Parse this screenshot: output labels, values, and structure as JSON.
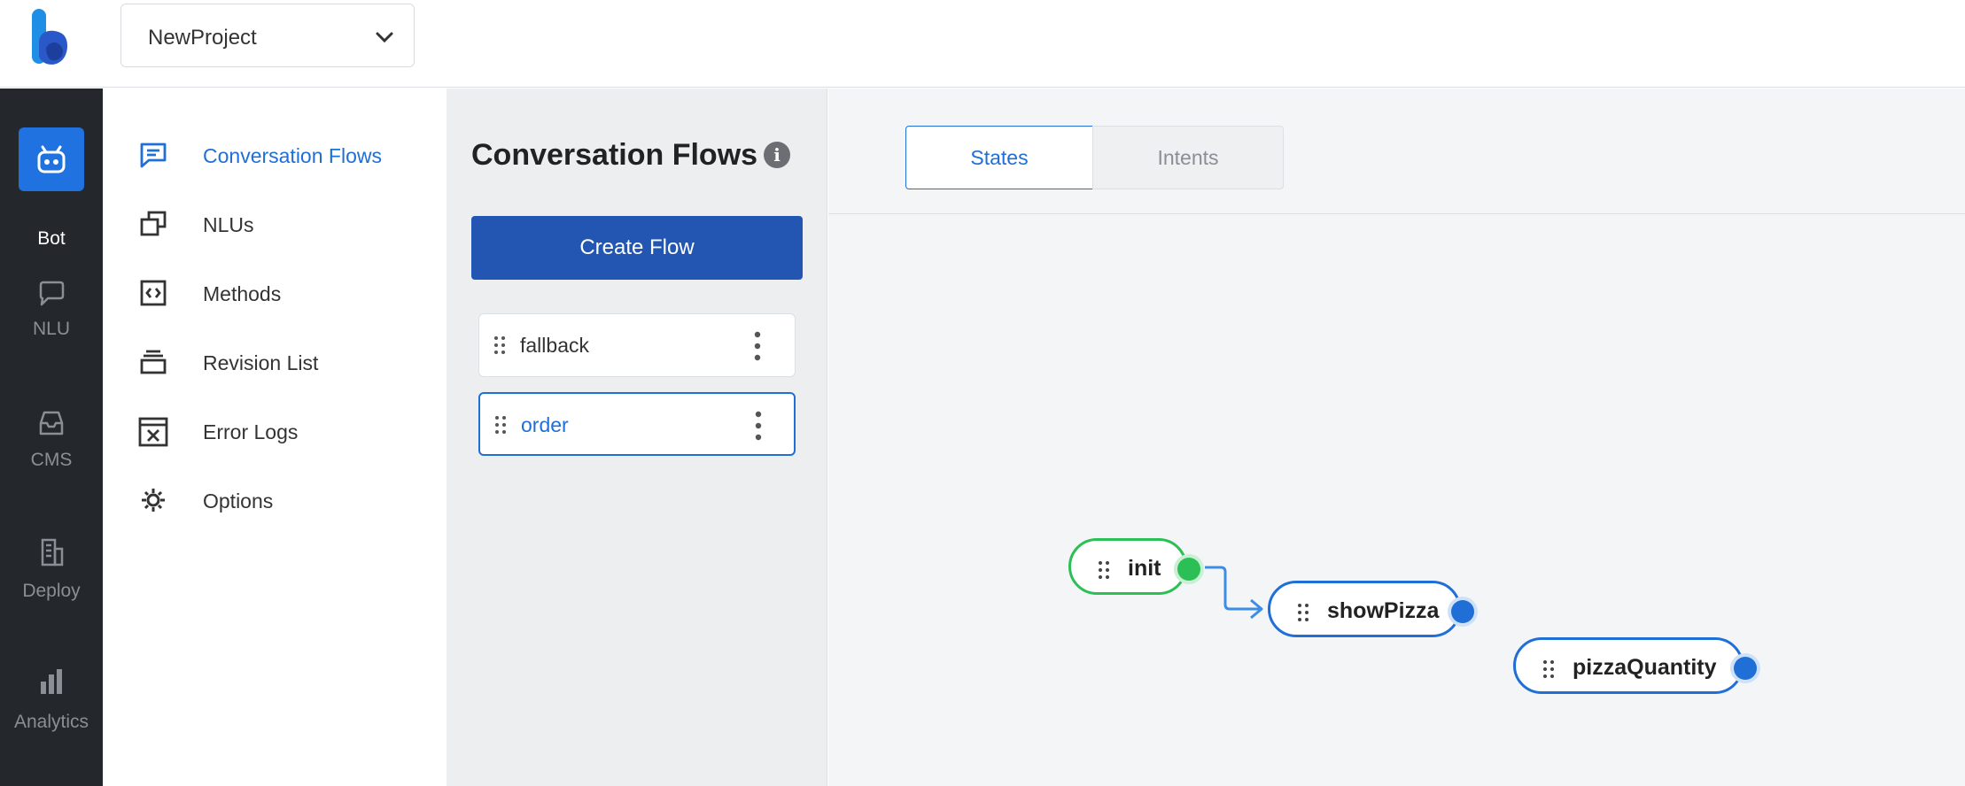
{
  "app": {
    "logo_icon": "logo-k-icon",
    "accent": "#1f72e0"
  },
  "project_select": {
    "value": "NewProject",
    "icon": "chevron-down-icon"
  },
  "rail": {
    "items": [
      {
        "label": "Bot",
        "icon": "robot-icon",
        "active": true
      },
      {
        "label": "NLU",
        "icon": "chat-bubble-icon",
        "active": false
      },
      {
        "label": "CMS",
        "icon": "inbox-icon",
        "active": false
      },
      {
        "label": "Deploy",
        "icon": "building-icon",
        "active": false
      },
      {
        "label": "Analytics",
        "icon": "bar-chart-icon",
        "active": false
      }
    ]
  },
  "subnav": {
    "items": [
      {
        "label": "Conversation Flows",
        "icon": "message-square-icon",
        "active": true
      },
      {
        "label": "NLUs",
        "icon": "copy-windows-icon",
        "active": false
      },
      {
        "label": "Methods",
        "icon": "code-box-icon",
        "active": false
      },
      {
        "label": "Revision List",
        "icon": "stack-icon",
        "active": false
      },
      {
        "label": "Error Logs",
        "icon": "error-window-icon",
        "active": false
      },
      {
        "label": "Options",
        "icon": "gear-icon",
        "active": false
      }
    ]
  },
  "flows_panel": {
    "title": "Conversation Flows",
    "info_glyph": "i",
    "create_button": "Create Flow",
    "flows": [
      {
        "name": "fallback",
        "active": false
      },
      {
        "name": "order",
        "active": true
      }
    ]
  },
  "canvas": {
    "tabs": [
      {
        "label": "States",
        "active": true
      },
      {
        "label": "Intents",
        "active": false
      }
    ],
    "nodes": [
      {
        "label": "init",
        "type": "start",
        "color": "#2bbf55"
      },
      {
        "label": "showPizza",
        "type": "state",
        "color": "#1f6fd6"
      },
      {
        "label": "pizzaQuantity",
        "type": "state",
        "color": "#1f6fd6"
      }
    ],
    "edges": [
      {
        "from": "init",
        "to": "showPizza"
      }
    ]
  }
}
